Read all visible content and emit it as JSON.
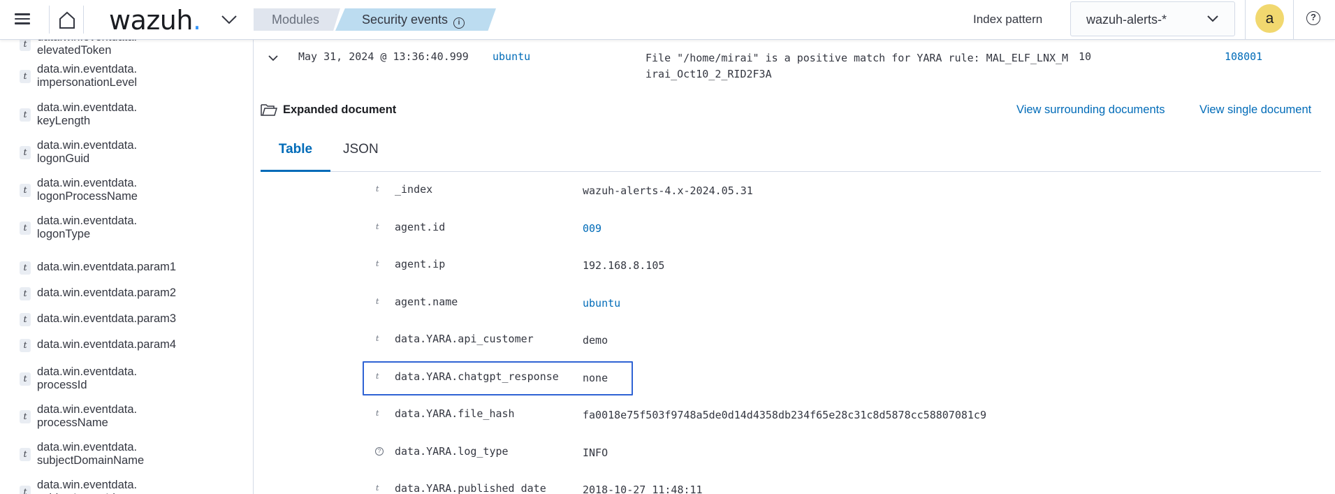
{
  "header": {
    "logo_text": "wazuh",
    "logo_dot": ".",
    "breadcrumbs": [
      "Modules",
      "Security events"
    ],
    "index_pattern_label": "Index pattern",
    "index_pattern_value": "wazuh-alerts-*",
    "avatar_letter": "a",
    "help_glyph": "?"
  },
  "sidebar": {
    "fields": [
      {
        "type": "t",
        "line1": "data.win.eventdata.",
        "line2": "elevatedToken"
      },
      {
        "type": "t",
        "line1": "data.win.eventdata.",
        "line2": "impersonationLevel"
      },
      {
        "type": "t",
        "line1": "data.win.eventdata.",
        "line2": "keyLength"
      },
      {
        "type": "t",
        "line1": "data.win.eventdata.",
        "line2": "logonGuid"
      },
      {
        "type": "t",
        "line1": "data.win.eventdata.",
        "line2": "logonProcessName"
      },
      {
        "type": "t",
        "line1": "data.win.eventdata.",
        "line2": "logonType"
      },
      {
        "type": "t",
        "line1": "data.win.eventdata.param1",
        "line2": ""
      },
      {
        "type": "t",
        "line1": "data.win.eventdata.param2",
        "line2": ""
      },
      {
        "type": "t",
        "line1": "data.win.eventdata.param3",
        "line2": ""
      },
      {
        "type": "t",
        "line1": "data.win.eventdata.param4",
        "line2": ""
      },
      {
        "type": "t",
        "line1": "data.win.eventdata.",
        "line2": "processId"
      },
      {
        "type": "t",
        "line1": "data.win.eventdata.",
        "line2": "processName"
      },
      {
        "type": "t",
        "line1": "data.win.eventdata.",
        "line2": "subjectDomainName"
      },
      {
        "type": "t",
        "line1": "data.win.eventdata.",
        "line2": "subjectLogonId"
      }
    ]
  },
  "event": {
    "timestamp": "May 31, 2024 @ 13:36:40.999",
    "agent_name": "ubuntu",
    "description": "File \"/home/mirai\" is a positive match for YARA rule: MAL_ELF_LNX_Mirai_Oct10_2_RID2F3A",
    "rule_level": "10",
    "rule_id": "108001"
  },
  "expanded": {
    "title": "Expanded document",
    "view_surrounding": "View surrounding documents",
    "view_single": "View single document",
    "tabs": [
      "Table",
      "JSON"
    ],
    "rows": [
      {
        "type": "t",
        "key": "_index",
        "value": "wazuh-alerts-4.x-2024.05.31",
        "link": false
      },
      {
        "type": "t",
        "key": "agent.id",
        "value": "009",
        "link": true
      },
      {
        "type": "t",
        "key": "agent.ip",
        "value": "192.168.8.105",
        "link": false
      },
      {
        "type": "t",
        "key": "agent.name",
        "value": "ubuntu",
        "link": true
      },
      {
        "type": "t",
        "key": "data.YARA.api_customer",
        "value": "demo",
        "link": false
      },
      {
        "type": "t",
        "key": "data.YARA.chatgpt_response",
        "value": "none",
        "link": false
      },
      {
        "type": "t",
        "key": "data.YARA.file_hash",
        "value": "fa0018e75f503f9748a5de0d14d4358db234f65e28c31c8d5878cc58807081c9",
        "link": false
      },
      {
        "type": "?",
        "key": "data.YARA.log_type",
        "value": "INFO",
        "link": false
      },
      {
        "type": "t",
        "key": "data.YARA.published_date",
        "value": "2018-10-27 11:48:11",
        "link": false
      }
    ]
  },
  "colors": {
    "link": "#006bb8",
    "breadcrumb_active": "#bcdcf0",
    "avatar": "#f1d86f",
    "highlight_border": "#2f63d4"
  }
}
